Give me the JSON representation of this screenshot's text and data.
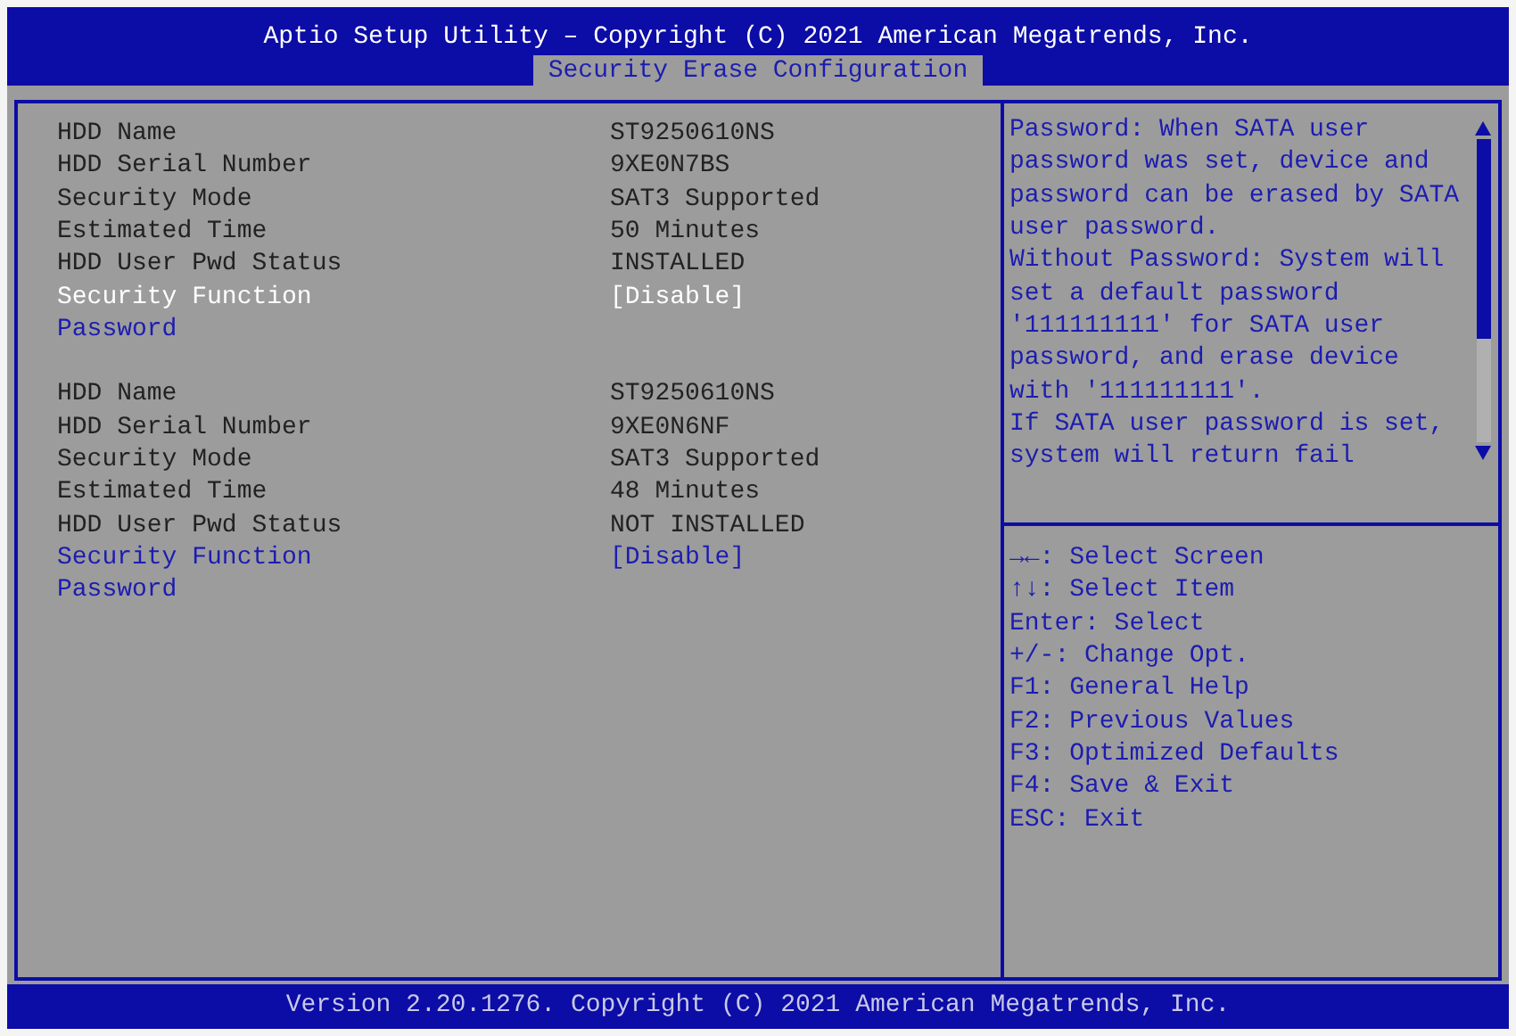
{
  "header": {
    "title": "Aptio Setup Utility – Copyright (C) 2021 American Megatrends, Inc.",
    "tab": {
      "label": "Security Erase Configuration",
      "selected": true
    }
  },
  "groups": [
    {
      "items": [
        {
          "kind": "info",
          "label": "HDD Name",
          "value": "ST9250610NS",
          "selected": false
        },
        {
          "kind": "info",
          "label": "HDD Serial Number",
          "value": "9XE0N7BS",
          "selected": false
        },
        {
          "kind": "info",
          "label": "Security Mode",
          "value": "SAT3 Supported",
          "selected": false
        },
        {
          "kind": "info",
          "label": "Estimated Time",
          "value": "50 Minutes",
          "selected": false
        },
        {
          "kind": "info",
          "label": "HDD User Pwd Status",
          "value": "INSTALLED",
          "selected": false
        },
        {
          "kind": "option",
          "label": "Security Function",
          "value": "[Disable]",
          "selected": true
        },
        {
          "kind": "option",
          "label": "Password",
          "selected": false
        }
      ]
    },
    {
      "items": [
        {
          "kind": "info",
          "label": "HDD Name",
          "value": "ST9250610NS",
          "selected": false
        },
        {
          "kind": "info",
          "label": "HDD Serial Number",
          "value": "9XE0N6NF",
          "selected": false
        },
        {
          "kind": "info",
          "label": "Security Mode",
          "value": "SAT3 Supported",
          "selected": false
        },
        {
          "kind": "info",
          "label": "Estimated Time",
          "value": "48 Minutes",
          "selected": false
        },
        {
          "kind": "info",
          "label": "HDD User Pwd Status",
          "value": "NOT INSTALLED",
          "selected": false
        },
        {
          "kind": "option",
          "label": "Security Function",
          "value": "[Disable]",
          "selected": false
        },
        {
          "kind": "option",
          "label": "Password",
          "selected": false
        }
      ]
    }
  ],
  "help": {
    "paragraphs": [
      "Password: When SATA user password was set, device and password can be erased by SATA user password.",
      "Without Password: System will set a default password '111111111' for SATA user password, and erase device with '111111111'.",
      "If SATA user password is set, system will return fail"
    ]
  },
  "keys": [
    "→←: Select Screen",
    "↑↓: Select Item",
    "Enter: Select",
    "+/-: Change Opt.",
    "F1: General Help",
    "F2: Previous Values",
    "F3: Optimized Defaults",
    "F4: Save & Exit",
    "ESC: Exit"
  ],
  "footer": "Version 2.20.1276. Copyright (C) 2021 American Megatrends, Inc."
}
